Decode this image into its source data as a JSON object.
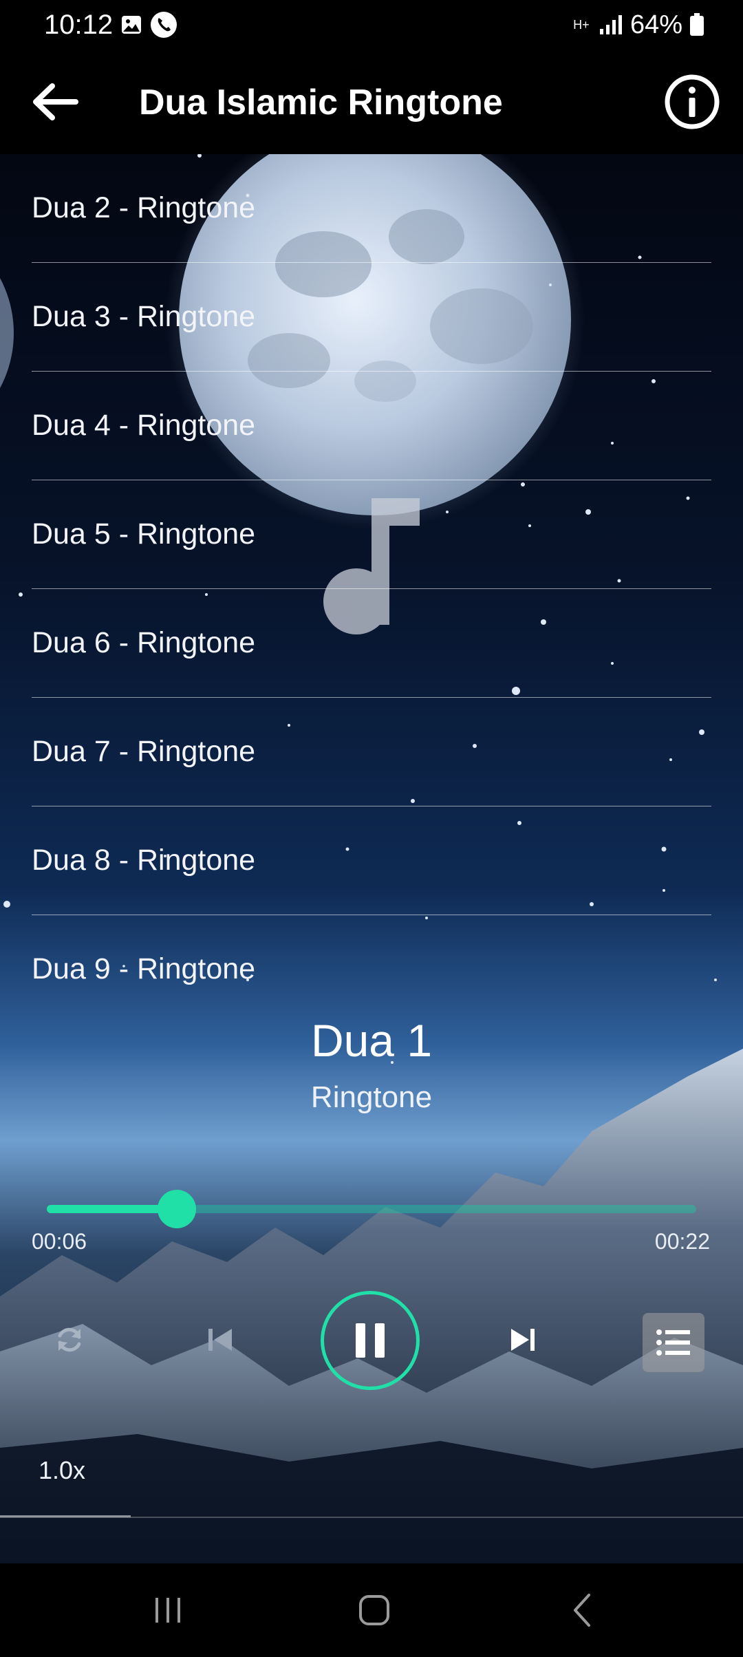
{
  "status_bar": {
    "time": "10:12",
    "network": "H+",
    "battery": "64%"
  },
  "app_bar": {
    "title": "Dua Islamic Ringtone"
  },
  "track_list": [
    "Dua 2 - Ringtone",
    "Dua 3 - Ringtone",
    "Dua 4 - Ringtone",
    "Dua 5 - Ringtone",
    "Dua 6 - Ringtone",
    "Dua 7 - Ringtone",
    "Dua 8 - Ringtone",
    "Dua 9 - Ringtone"
  ],
  "now_playing": {
    "title": "Dua 1",
    "subtitle": "Ringtone",
    "current_time": "00:06",
    "total_time": "00:22",
    "progress_fraction": 0.2,
    "speed": "1.0x"
  },
  "colors": {
    "accent": "#20e0a8",
    "background": "#000000"
  },
  "icons": {
    "back": "arrow-left-icon",
    "info": "info-circle-icon",
    "repeat": "repeat-icon",
    "previous": "skip-previous-icon",
    "play_pause": "pause-icon",
    "next": "skip-next-icon",
    "playlist": "playlist-icon"
  }
}
